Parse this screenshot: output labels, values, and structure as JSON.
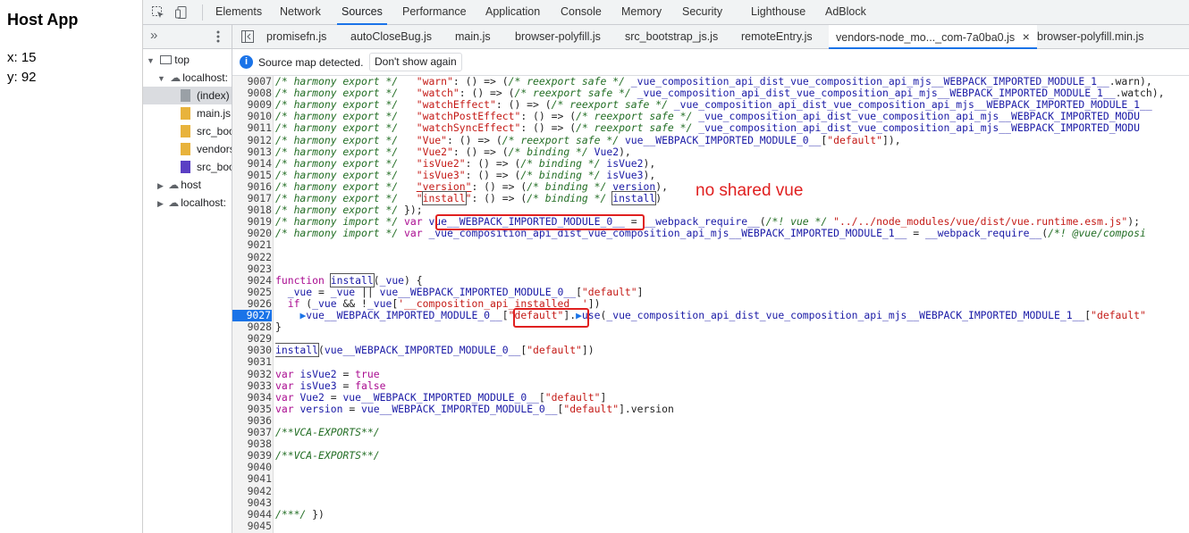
{
  "host_app": {
    "title": "Host App",
    "x_label": "x: 15",
    "y_label": "y: 92"
  },
  "devtools": {
    "main_tabs": [
      "Elements",
      "Network",
      "Sources",
      "Performance",
      "Application",
      "Console",
      "Memory",
      "Security",
      "Lighthouse",
      "AdBlock"
    ],
    "active_main_tab": "Sources",
    "file_tabs": [
      "promisefn.js",
      "autoCloseBug.js",
      "main.js",
      "browser-polyfill.js",
      "src_bootstrap_js.js",
      "remoteEntry.js",
      "vendors-node_mo..._com-7a0ba0.js",
      "browser-polyfill.min.js"
    ],
    "active_file_tab": "vendors-node_mo..._com-7a0ba0.js",
    "close_glyph": "×",
    "more_glyph": "»",
    "tree": {
      "top": "top",
      "localhost1": "localhost:",
      "index": "(index)",
      "mainjs": "main.js",
      "srcboo1": "src_boo",
      "vendors": "vendors",
      "srcboo2": "src_boo",
      "host": "host",
      "localhost2": "localhost:"
    },
    "infobar": {
      "message": "Source map detected.",
      "button": "Don't show again"
    }
  },
  "code": {
    "line_numbers": [
      "9007",
      "9008",
      "9009",
      "9010",
      "9011",
      "9012",
      "9013",
      "9014",
      "9015",
      "9016",
      "9017",
      "9018",
      "9019",
      "9020",
      "9021",
      "9022",
      "9023",
      "9024",
      "9025",
      "9026",
      "9027",
      "9028",
      "9029",
      "9030",
      "9031",
      "9032",
      "9033",
      "9034",
      "9035",
      "9036",
      "9037",
      "9038",
      "9039",
      "9040",
      "9041",
      "9042",
      "9043",
      "9044",
      "9045"
    ],
    "breakpoint_line": "9027",
    "annotation": "no shared vue"
  }
}
